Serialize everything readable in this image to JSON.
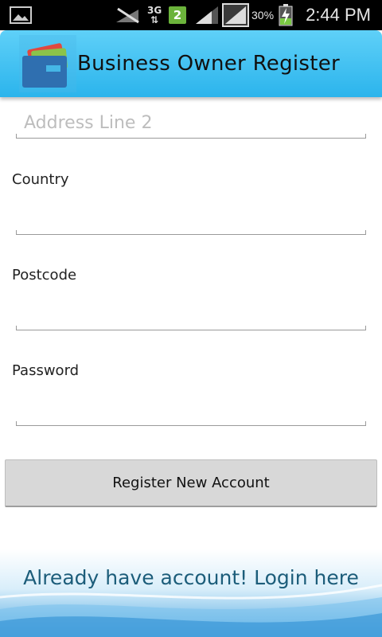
{
  "status_bar": {
    "network": "3G",
    "sim_badge": "2",
    "battery_percent": "30%",
    "time": "2:44 PM"
  },
  "app_bar": {
    "title": "Business Owner Register"
  },
  "form": {
    "address_line_2": {
      "placeholder": "Address Line 2",
      "value": ""
    },
    "country": {
      "label": "Country",
      "value": ""
    },
    "postcode": {
      "label": "Postcode",
      "value": ""
    },
    "password": {
      "label": "Password",
      "value": ""
    },
    "register_button": "Register New Account"
  },
  "footer": {
    "login_link": "Already have account! Login here"
  },
  "colors": {
    "app_bar_top": "#5fd0f8",
    "app_bar_bottom": "#2bb4ec",
    "login_link": "#1c5d7a",
    "button_bg": "#d8d8d8"
  }
}
